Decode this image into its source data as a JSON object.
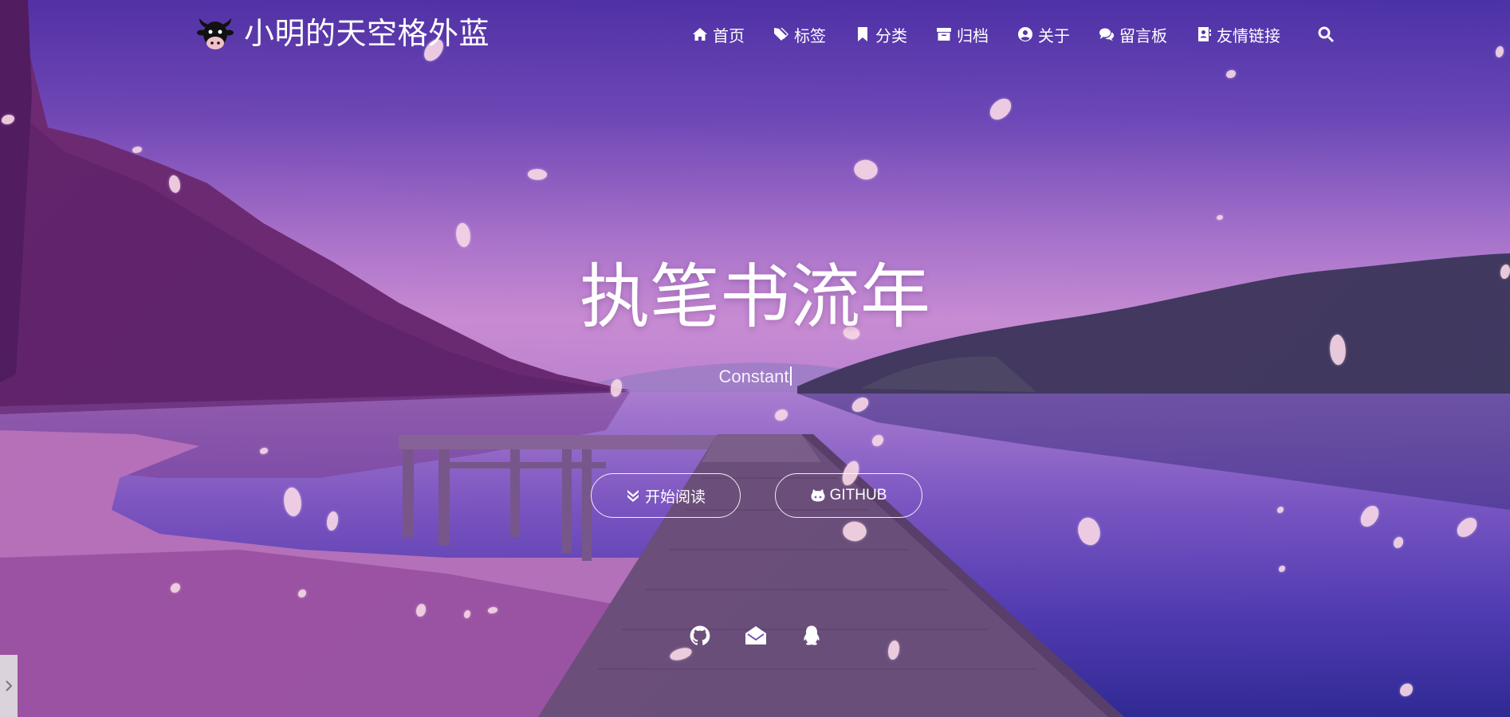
{
  "brand": {
    "title": "小明的天空格外蓝",
    "logo_icon": "cow-icon"
  },
  "nav": {
    "items": [
      {
        "label": "首页",
        "icon": "home-icon"
      },
      {
        "label": "标签",
        "icon": "tags-icon"
      },
      {
        "label": "分类",
        "icon": "bookmark-icon"
      },
      {
        "label": "归档",
        "icon": "archive-icon"
      },
      {
        "label": "关于",
        "icon": "user-circle-icon"
      },
      {
        "label": "留言板",
        "icon": "comments-icon"
      },
      {
        "label": "友情链接",
        "icon": "address-book-icon"
      }
    ],
    "search_icon": "search-icon"
  },
  "hero": {
    "title": "执笔书流年",
    "typed_text": "Constant",
    "buttons": {
      "read": "开始阅读",
      "github": "GITHUB"
    }
  },
  "socials": [
    "github-icon",
    "envelope-open-icon",
    "qq-icon"
  ],
  "colors": {
    "accent_text": "#ffffff",
    "petal": "#f7d6e6",
    "sky_top": "#4a33a6",
    "sky_horizon": "#d79bd9"
  }
}
